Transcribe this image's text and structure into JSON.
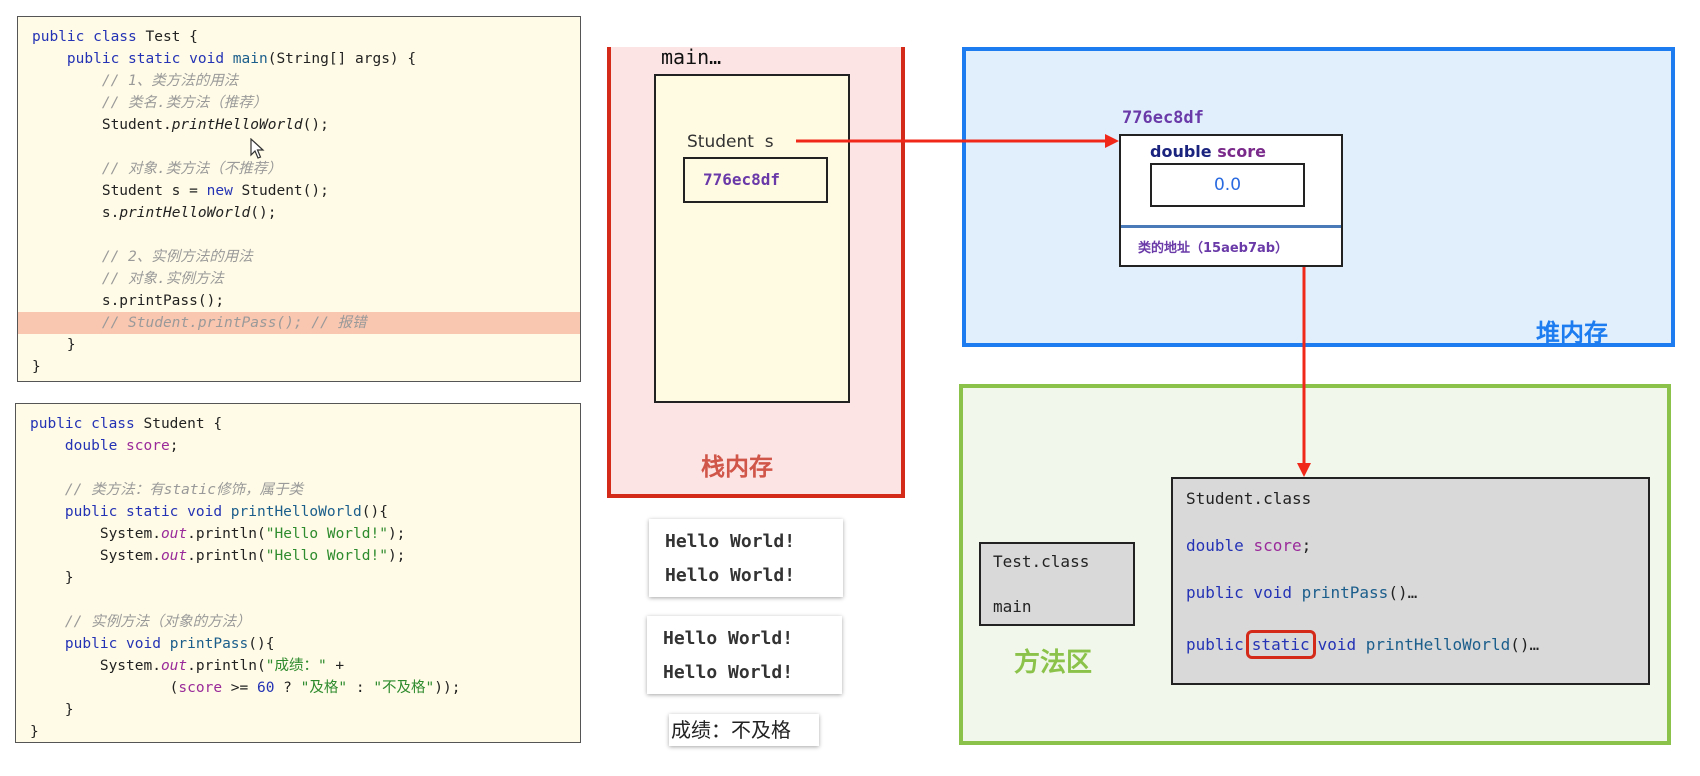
{
  "test_code": {
    "highlight_line": 13,
    "lines": [
      [
        [
          "public class",
          "kw"
        ],
        [
          " Test {",
          "plain"
        ]
      ],
      [
        [
          "    ",
          "plain"
        ],
        [
          "public static void",
          "kw"
        ],
        [
          " ",
          "plain"
        ],
        [
          "main",
          "fn"
        ],
        [
          "(String[] args) {",
          "plain"
        ]
      ],
      [
        [
          "        // 1、类方法的用法",
          "cm"
        ]
      ],
      [
        [
          "        // 类名.类方法（推荐）",
          "cm"
        ]
      ],
      [
        [
          "        Student.",
          "plain"
        ],
        [
          "printHelloWorld",
          "it"
        ],
        [
          "();",
          "plain"
        ]
      ],
      [],
      [
        [
          "        // 对象.类方法（不推荐）",
          "cm"
        ]
      ],
      [
        [
          "        Student s = ",
          "plain"
        ],
        [
          "new",
          "kw"
        ],
        [
          " Student();",
          "plain"
        ]
      ],
      [
        [
          "        s.",
          "plain"
        ],
        [
          "printHelloWorld",
          "it"
        ],
        [
          "();",
          "plain"
        ]
      ],
      [],
      [
        [
          "        // 2、实例方法的用法",
          "cm"
        ]
      ],
      [
        [
          "        // 对象.实例方法",
          "cm"
        ]
      ],
      [
        [
          "        s.printPass();",
          "plain"
        ]
      ],
      [
        [
          "        // Student.printPass(); // 报错",
          "cm"
        ]
      ],
      [
        [
          "    }",
          "plain"
        ]
      ],
      [
        [
          "}",
          "plain"
        ]
      ]
    ]
  },
  "student_code": {
    "lines": [
      [
        [
          "public class",
          "kw"
        ],
        [
          " Student {",
          "plain"
        ]
      ],
      [
        [
          "    ",
          "plain"
        ],
        [
          "double",
          "kw"
        ],
        [
          " ",
          "plain"
        ],
        [
          "score",
          "fld"
        ],
        [
          ";",
          "plain"
        ]
      ],
      [],
      [
        [
          "    // 类方法：有static修饰，属于类",
          "cm"
        ]
      ],
      [
        [
          "    ",
          "plain"
        ],
        [
          "public static void",
          "kw"
        ],
        [
          " ",
          "plain"
        ],
        [
          "printHelloWorld",
          "fn"
        ],
        [
          "(){",
          "plain"
        ]
      ],
      [
        [
          "        System.",
          "plain"
        ],
        [
          "out",
          "itp"
        ],
        [
          ".println(",
          "plain"
        ],
        [
          "\"Hello World!\"",
          "str"
        ],
        [
          ");",
          "plain"
        ]
      ],
      [
        [
          "        System.",
          "plain"
        ],
        [
          "out",
          "itp"
        ],
        [
          ".println(",
          "plain"
        ],
        [
          "\"Hello World!\"",
          "str"
        ],
        [
          ");",
          "plain"
        ]
      ],
      [
        [
          "    }",
          "plain"
        ]
      ],
      [],
      [
        [
          "    // 实例方法（对象的方法）",
          "cm"
        ]
      ],
      [
        [
          "    ",
          "plain"
        ],
        [
          "public void",
          "kw"
        ],
        [
          " ",
          "plain"
        ],
        [
          "printPass",
          "fn"
        ],
        [
          "(){",
          "plain"
        ]
      ],
      [
        [
          "        System.",
          "plain"
        ],
        [
          "out",
          "itp"
        ],
        [
          ".println(",
          "plain"
        ],
        [
          "\"成绩：\"",
          "str"
        ],
        [
          " +",
          "plain"
        ]
      ],
      [
        [
          "                (",
          "plain"
        ],
        [
          "score",
          "fld"
        ],
        [
          " >= ",
          "plain"
        ],
        [
          "60",
          "num"
        ],
        [
          " ? ",
          "plain"
        ],
        [
          "\"及格\"",
          "str"
        ],
        [
          " : ",
          "plain"
        ],
        [
          "\"不及格\"",
          "str"
        ],
        [
          "));",
          "plain"
        ]
      ],
      [
        [
          "    }",
          "plain"
        ]
      ],
      [
        [
          "}",
          "plain"
        ]
      ]
    ]
  },
  "stack": {
    "label": "栈内存",
    "frame_name": "main…",
    "variable": "Student  s",
    "variable_value": "776ec8df",
    "color": "#d42a1a"
  },
  "console": {
    "output1": [
      "Hello World!",
      "Hello World!"
    ],
    "output2": [
      "Hello World!",
      "Hello World!"
    ],
    "output3": "成绩：不及格"
  },
  "heap": {
    "label": "堆内存",
    "color": "#1c7cf0",
    "object_address": "776ec8df",
    "field_type": "double",
    "field_name": "score",
    "field_value": "0.0",
    "class_address": "类的地址（15aeb7ab）"
  },
  "method_area": {
    "label": "方法区",
    "color": "#8bc34a",
    "test_class": {
      "name": "Test.class",
      "member": "main"
    },
    "student_class": {
      "name": "Student.class",
      "field": {
        "type": "double",
        "name": "score",
        "end": ";"
      },
      "instance_method": {
        "mod": "public void",
        "name": "printPass",
        "rest": "()…"
      },
      "static_method": {
        "mod1": "public",
        "static": "static",
        "mod2": "void",
        "name": "printHelloWorld",
        "rest": "()…"
      }
    }
  },
  "arrow_color": "#f0281a"
}
